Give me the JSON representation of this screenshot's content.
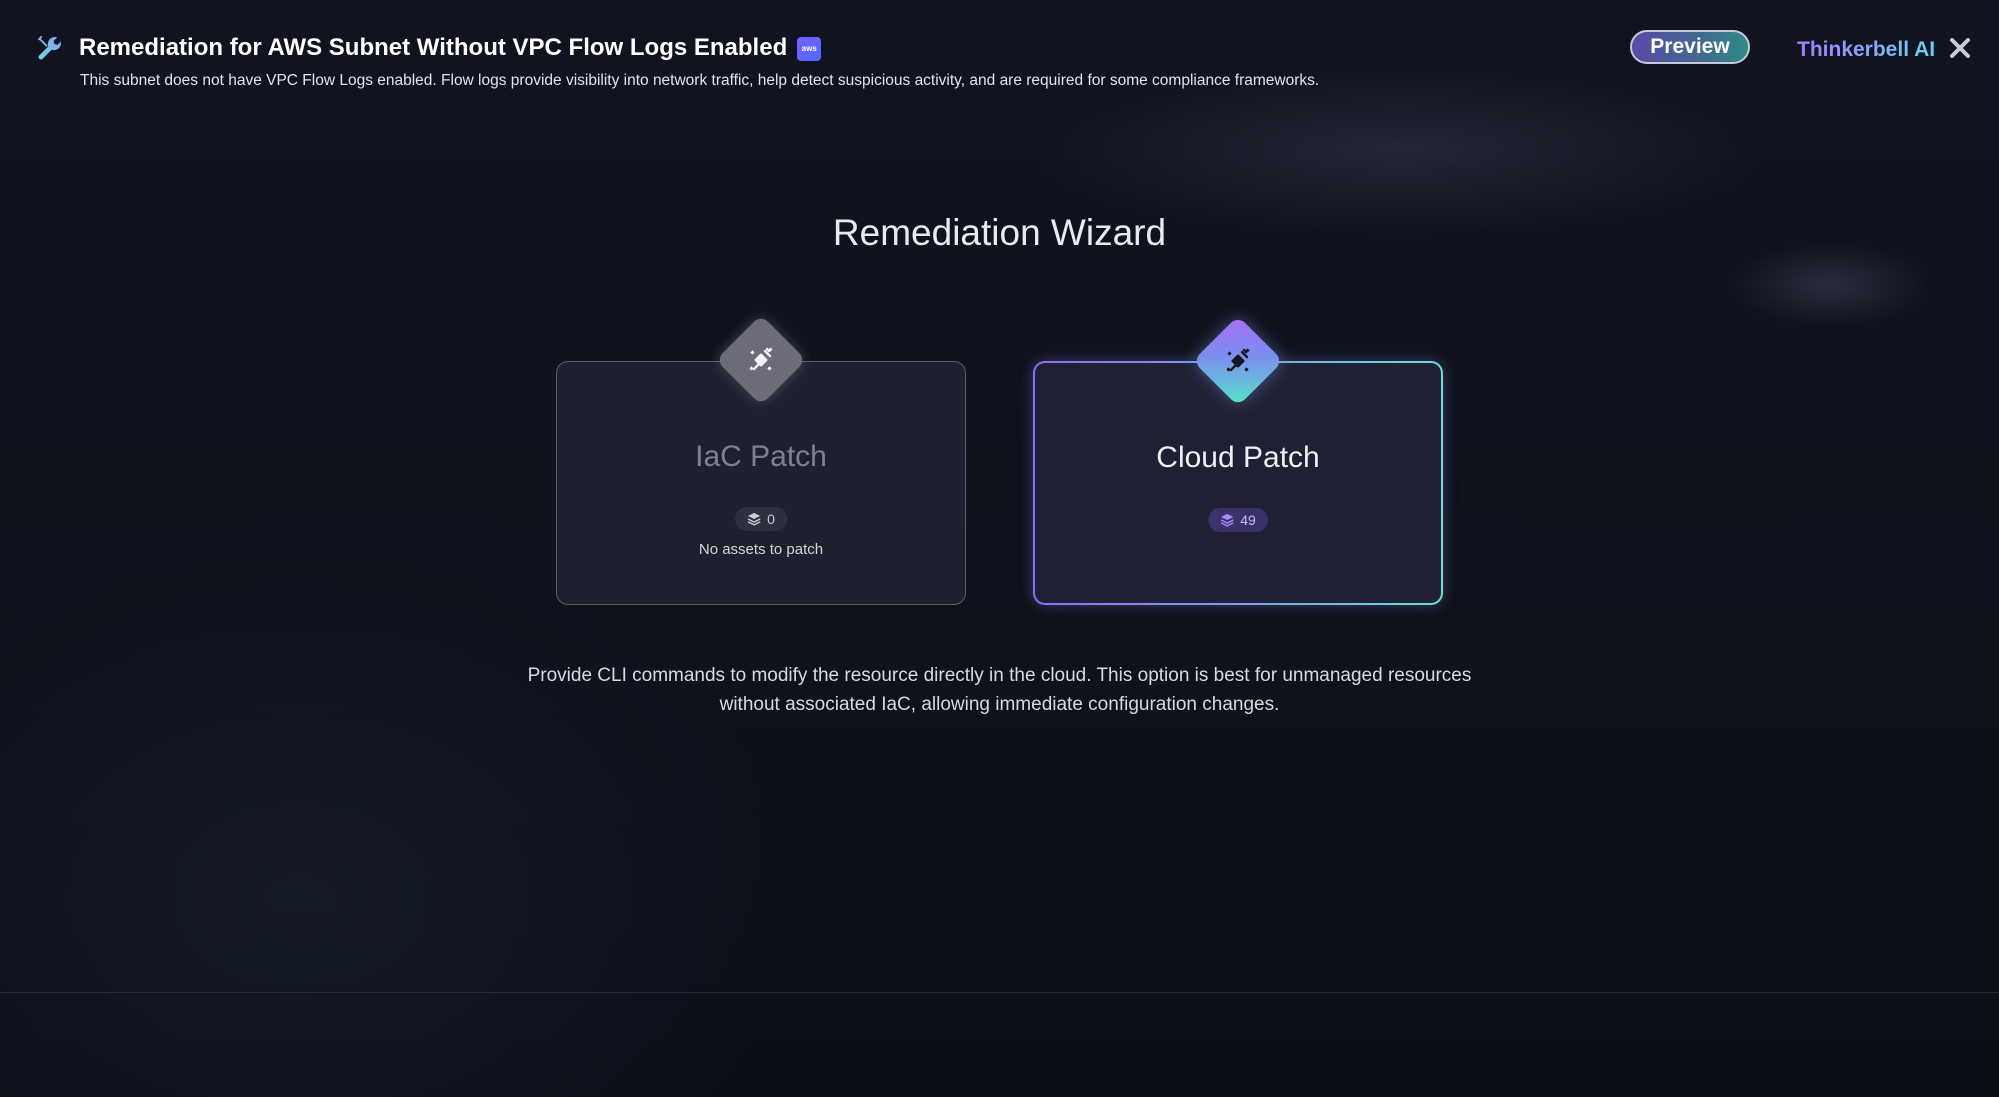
{
  "header": {
    "title": "Remediation for AWS Subnet Without VPC Flow Logs Enabled",
    "aws_badge": "aws",
    "subtitle": "This subnet does not have VPC Flow Logs enabled. Flow logs provide visibility into network traffic, help detect suspicious activity, and are required for some compliance frameworks.",
    "preview_label": "Preview",
    "brand": "Thinkerbell AI",
    "icons": {
      "title_icon": "wrench-icon",
      "close_icon": "close-icon"
    }
  },
  "wizard": {
    "title": "Remediation Wizard",
    "options": [
      {
        "title": "IaC Patch",
        "count": "0",
        "note": "No assets to patch",
        "icon": "patch-icon",
        "state": "disabled"
      },
      {
        "title": "Cloud Patch",
        "count": "49",
        "note": "",
        "icon": "patch-icon",
        "state": "selected"
      }
    ],
    "description": "Provide CLI commands to modify the resource directly in the cloud. This option is best for unmanaged resources without associated IaC, allowing immediate configuration changes."
  },
  "colors": {
    "background": "#0e1019",
    "accent_purple": "#8f6df5",
    "accent_teal": "#69e0d4",
    "card_background": "#1f2031"
  }
}
